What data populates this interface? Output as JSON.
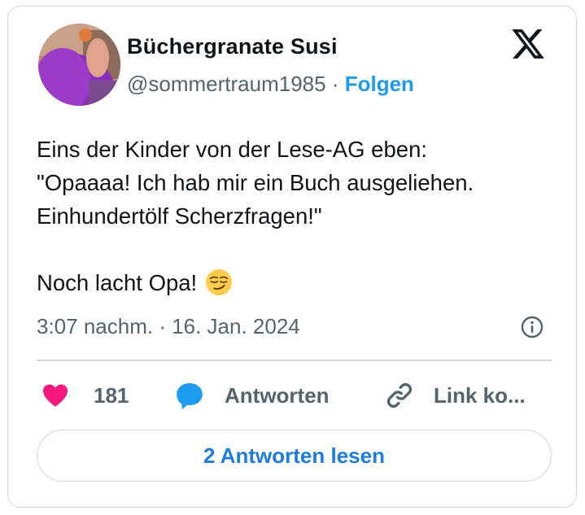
{
  "tweet": {
    "author": {
      "display_name": "Büchergranate Susi",
      "handle": "@sommertraum1985",
      "separator": " · ",
      "follow_label": "Folgen"
    },
    "text": "Eins der Kinder von der Lese-AG eben:\n\"Opaaaa! Ich hab mir ein Buch ausgeliehen.\nEinhundertölf Scherzfragen!\"\n\nNoch lacht Opa! ",
    "trailing_emoji": "smirking-face",
    "timestamp": "3:07 nachm. · 16. Jan. 2024",
    "actions": {
      "likes": "181",
      "reply_label": "Antworten",
      "copy_link_label": "Link ko..."
    },
    "read_replies_label": "2 Antworten lesen"
  },
  "colors": {
    "accent": "#1d9bf0",
    "heart": "#f91880",
    "muted": "#536471",
    "border": "#cfd9de"
  },
  "icons": [
    "x-logo-icon",
    "smirking-face-emoji",
    "info-icon",
    "heart-icon",
    "reply-bubble-icon",
    "link-icon"
  ]
}
